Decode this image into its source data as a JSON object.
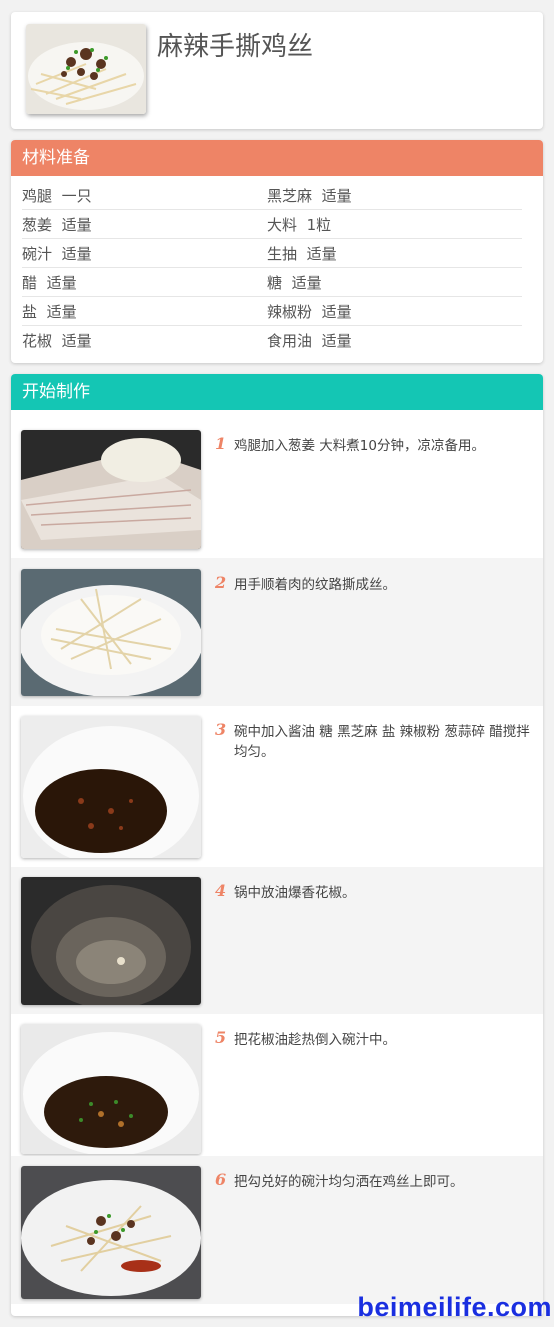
{
  "recipe": {
    "title": "麻辣手撕鸡丝"
  },
  "ingredients": {
    "header": "材料准备",
    "items": [
      {
        "name": "鸡腿",
        "amount": "一只"
      },
      {
        "name": "黑芝麻",
        "amount": "适量"
      },
      {
        "name": "葱姜",
        "amount": "适量"
      },
      {
        "name": "大料",
        "amount": "1粒"
      },
      {
        "name": "碗汁",
        "amount": "适量"
      },
      {
        "name": "生抽",
        "amount": "适量"
      },
      {
        "name": "醋",
        "amount": "适量"
      },
      {
        "name": "糖",
        "amount": "适量"
      },
      {
        "name": "盐",
        "amount": "适量"
      },
      {
        "name": "辣椒粉",
        "amount": "适量"
      },
      {
        "name": "花椒",
        "amount": "适量"
      },
      {
        "name": "食用油",
        "amount": "适量"
      }
    ]
  },
  "steps": {
    "header": "开始制作",
    "items": [
      {
        "num": "1",
        "text": "鸡腿加入葱姜 大料煮10分钟，凉凉备用。"
      },
      {
        "num": "2",
        "text": "用手顺着肉的纹路撕成丝。"
      },
      {
        "num": "3",
        "text": "碗中加入酱油 糖 黑芝麻 盐 辣椒粉 葱蒜碎 醋搅拌均匀。"
      },
      {
        "num": "4",
        "text": "锅中放油爆香花椒。"
      },
      {
        "num": "5",
        "text": "把花椒油趁热倒入碗汁中。"
      },
      {
        "num": "6",
        "text": "把勾兑好的碗汁均匀洒在鸡丝上即可。"
      }
    ]
  },
  "watermark": "beimeilife.com",
  "colors": {
    "ingredients_header": "#ee8466",
    "steps_header": "#14c6b4",
    "step_number": "#ee8466",
    "watermark": "#1a2fe0"
  }
}
